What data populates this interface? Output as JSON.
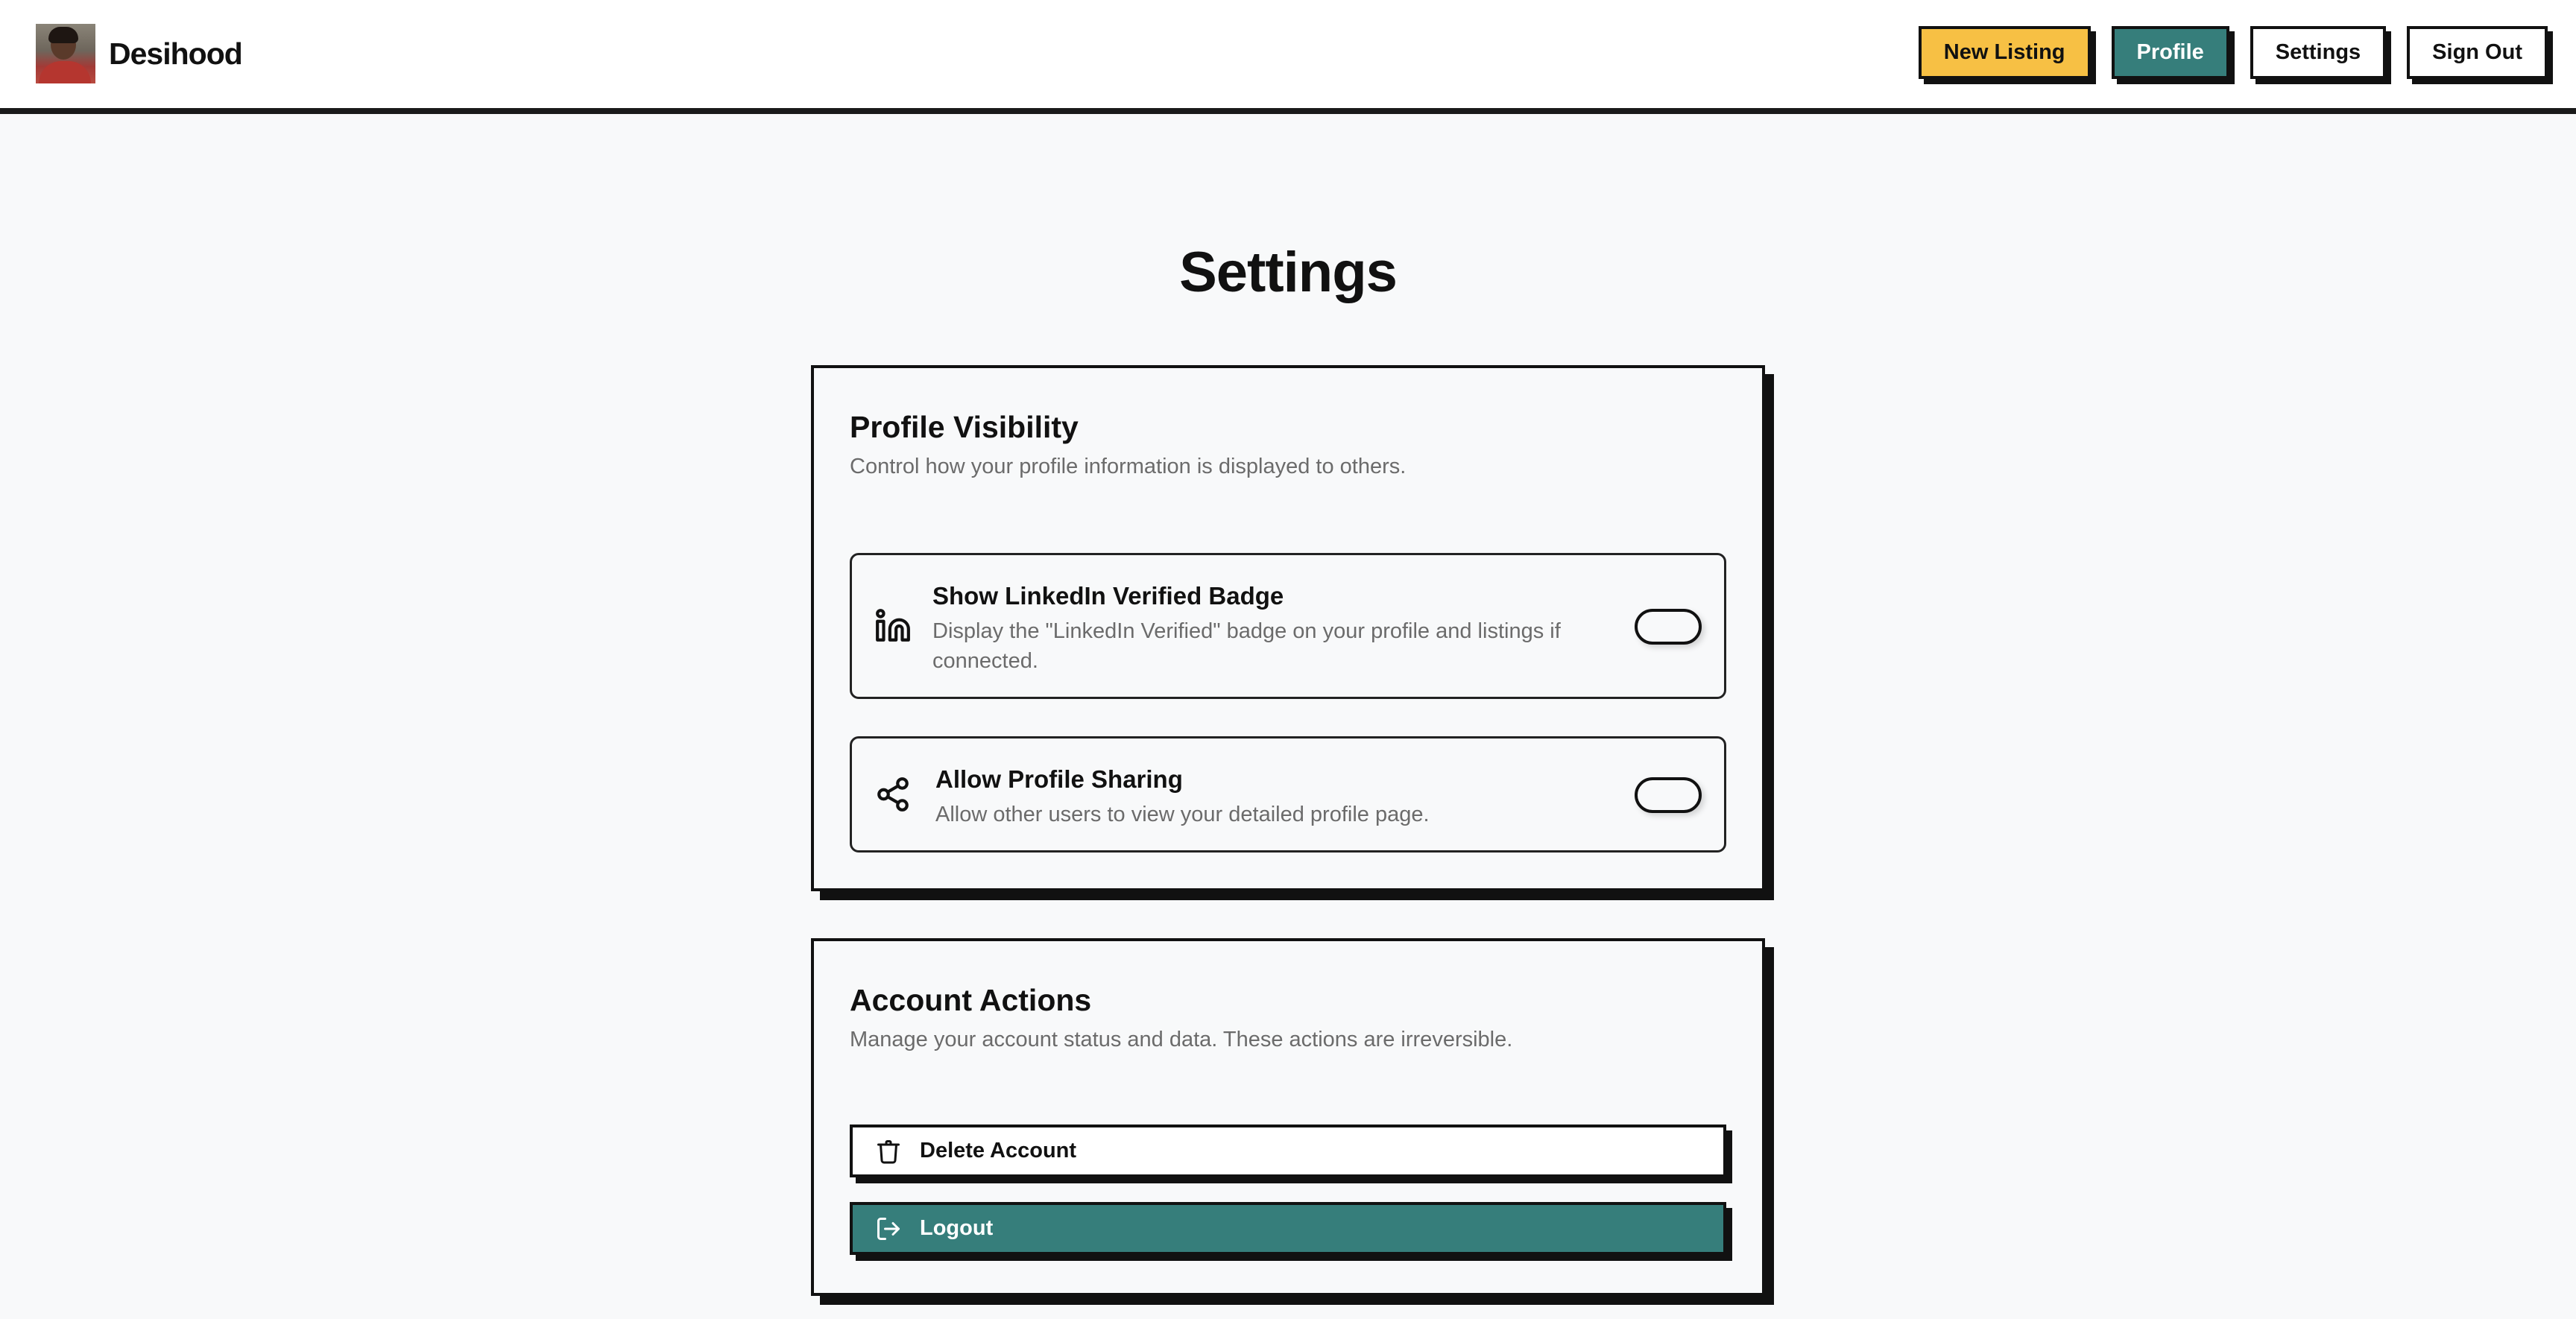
{
  "header": {
    "brand": "Desihood",
    "nav": {
      "new_listing": "New Listing",
      "profile": "Profile",
      "settings": "Settings",
      "sign_out": "Sign Out"
    }
  },
  "page": {
    "title": "Settings"
  },
  "profile_visibility": {
    "title": "Profile Visibility",
    "description": "Control how your profile information is displayed to others.",
    "settings": [
      {
        "icon": "linkedin-icon",
        "title": "Show LinkedIn Verified Badge",
        "description": "Display the \"LinkedIn Verified\" badge on your profile and listings if connected.",
        "enabled": false
      },
      {
        "icon": "share-icon",
        "title": "Allow Profile Sharing",
        "description": "Allow other users to view your detailed profile page.",
        "enabled": false
      }
    ]
  },
  "account_actions": {
    "title": "Account Actions",
    "description": "Manage your account status and data. These actions are irreversible.",
    "delete_label": "Delete Account",
    "logout_label": "Logout"
  },
  "colors": {
    "accent_yellow": "#f7c044",
    "accent_teal": "#367e7b",
    "border": "#111111",
    "background": "#f8f9fa"
  }
}
